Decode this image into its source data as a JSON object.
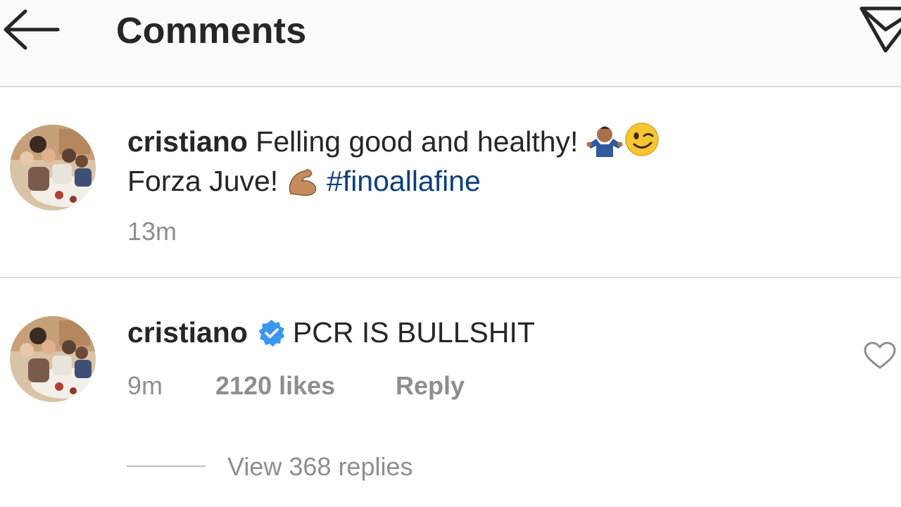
{
  "header": {
    "title": "Comments",
    "back_icon": "arrow-left-icon",
    "share_icon": "paper-plane-icon"
  },
  "caption": {
    "username": "cristiano",
    "text_line1": " Felling good and healthy! ",
    "text_line2": "Forza Juve! ",
    "hashtag": "#finoallafine",
    "emojis": [
      "person-shrugging-emoji",
      "winking-face-emoji",
      "flexed-biceps-emoji"
    ],
    "time": "13m"
  },
  "comment": {
    "username": "cristiano",
    "verified_icon": "verified-badge-icon",
    "text": "PCR IS BULLSHIT",
    "time": "9m",
    "likes": "2120 likes",
    "reply_label": "Reply",
    "like_icon": "heart-outline-icon",
    "view_replies": "View 368 replies"
  },
  "colors": {
    "text": "#262626",
    "secondary": "#8e8e8e",
    "hashtag": "#0b3e80",
    "verified": "#3897f0",
    "header_bg": "#fafafa"
  }
}
